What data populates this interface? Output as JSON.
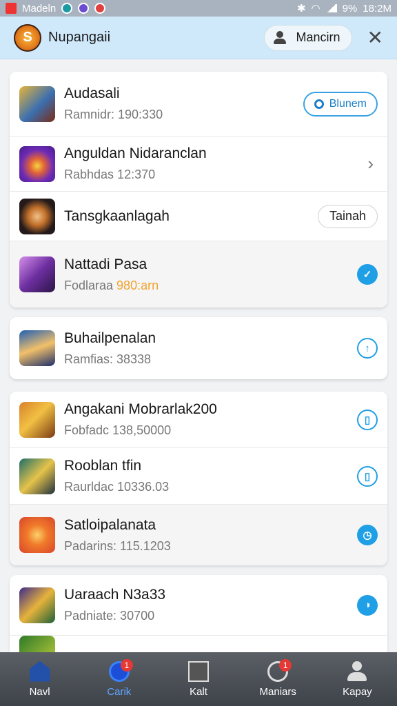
{
  "status_bar": {
    "carrier": "Madeln",
    "battery": "9%",
    "time": "18:2M"
  },
  "header": {
    "title": "Nupangaii",
    "account_label": "Mancirn",
    "logo_icon": "game-logo-icon",
    "close_icon": "close-icon"
  },
  "cards": [
    {
      "rows": [
        {
          "name": "Audasali",
          "sub": "Ramnidr: 190:330",
          "action": {
            "type": "pill-blue",
            "label": "Blunem"
          }
        },
        {
          "name": "Anguldan Nidaranclan",
          "sub": "Rabhdas 12:370",
          "action": {
            "type": "chevron"
          }
        },
        {
          "name": "Tansgkaanlagah",
          "sub": "",
          "action": {
            "type": "pill-grey",
            "label": "Tainah"
          }
        },
        {
          "name": "Nattadi Pasa",
          "sub_prefix": "Fodlaraa ",
          "sub_highlight": "980:arn",
          "action": {
            "type": "round-filled",
            "glyph": "✓"
          }
        }
      ]
    },
    {
      "rows": [
        {
          "name": "Buhailpenalan",
          "sub": "Ramfias: 38338",
          "action": {
            "type": "round-outline",
            "glyph": "↑"
          }
        }
      ]
    },
    {
      "rows": [
        {
          "name": "Angakani Mobrarlak200",
          "sub": "Fobfadc 138,50000",
          "action": {
            "type": "round-outline",
            "glyph": "▯"
          }
        },
        {
          "name": "Rooblan tfin",
          "sub": "Raurldac 10336.03",
          "action": {
            "type": "round-outline",
            "glyph": "▯"
          }
        },
        {
          "name": "Satloipalanata",
          "sub": "Padarins: 115.1203",
          "action": {
            "type": "round-filled",
            "glyph": "◷"
          }
        }
      ]
    },
    {
      "rows": [
        {
          "name": "Uaraach N3a33",
          "sub": "Padniate: 30700",
          "action": {
            "type": "round-filled",
            "glyph": "◑"
          }
        }
      ]
    }
  ],
  "bottom_nav": [
    {
      "label": "Navl",
      "icon": "home-icon"
    },
    {
      "label": "Carik",
      "icon": "game-icon",
      "badge": "1",
      "active": true
    },
    {
      "label": "Kalt",
      "icon": "box-icon"
    },
    {
      "label": "Maniars",
      "icon": "clock-icon",
      "badge": "1"
    },
    {
      "label": "Kapay",
      "icon": "person-icon"
    }
  ],
  "colors": {
    "header_bg": "#cfe9fb",
    "accent_blue": "#1f9fe6",
    "highlight_orange": "#f0a22f",
    "nav_bg": "#4a4e55"
  }
}
